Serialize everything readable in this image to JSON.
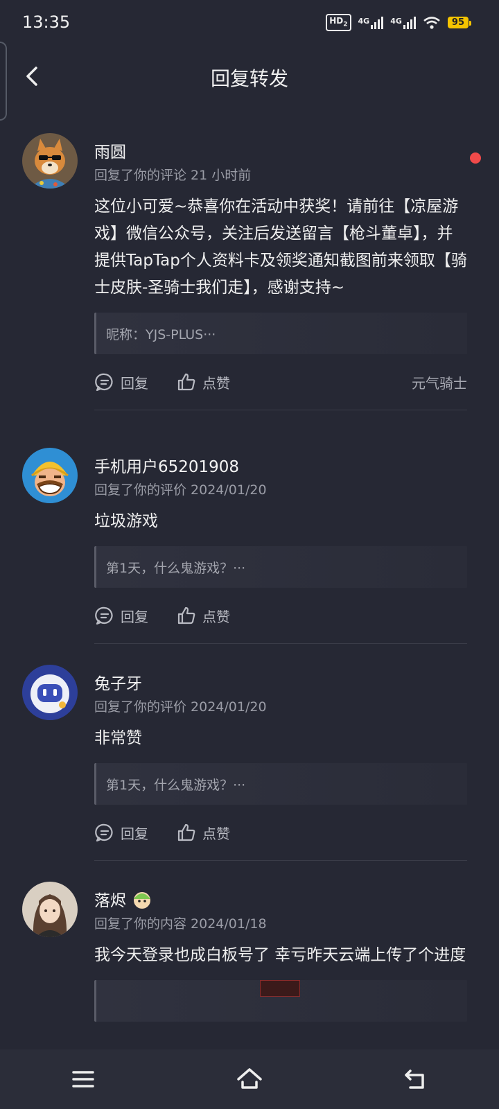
{
  "status_bar": {
    "time": "13:35",
    "hd": "HD",
    "hd_sub": "2",
    "net1": "4G",
    "net2": "4G",
    "battery": "95"
  },
  "header": {
    "title": "回复转发"
  },
  "notifications": [
    {
      "name": "雨圆",
      "meta": "回复了你的评论 21 小时前",
      "content": "这位小可爱~恭喜你在活动中获奖！请前往【凉屋游戏】微信公众号，关注后发送留言【枪斗董卓】，并提供TapTap个人资料卡及领奖通知截图前来领取【骑士皮肤-圣骑士我们走】，感谢支持~",
      "quote": "昵称：YJS-PLUS···",
      "reply_label": "回复",
      "like_label": "点赞",
      "game_tag": "元气骑士",
      "unread": true,
      "avatar_icon": "dog-sunglasses-avatar"
    },
    {
      "name": "手机用户65201908",
      "meta": "回复了你的评价 2024/01/20",
      "content": "垃圾游戏",
      "quote": "第1天，什么鬼游戏？···",
      "reply_label": "回复",
      "like_label": "点赞",
      "avatar_icon": "barbarian-avatar"
    },
    {
      "name": "兔子牙",
      "meta": "回复了你的评价 2024/01/20",
      "content": "非常赞",
      "quote": "第1天，什么鬼游戏？···",
      "reply_label": "回复",
      "like_label": "点赞",
      "avatar_icon": "robot-avatar"
    },
    {
      "name": "落烬",
      "meta": "回复了你的内容 2024/01/18",
      "content": "我今天登录也成白板号了  幸亏昨天云端上传了个进度",
      "avatar_icon": "anime-girl-avatar"
    }
  ],
  "colors": {
    "background": "#262834",
    "unread": "#f04a4a",
    "battery": "#f5c400"
  }
}
